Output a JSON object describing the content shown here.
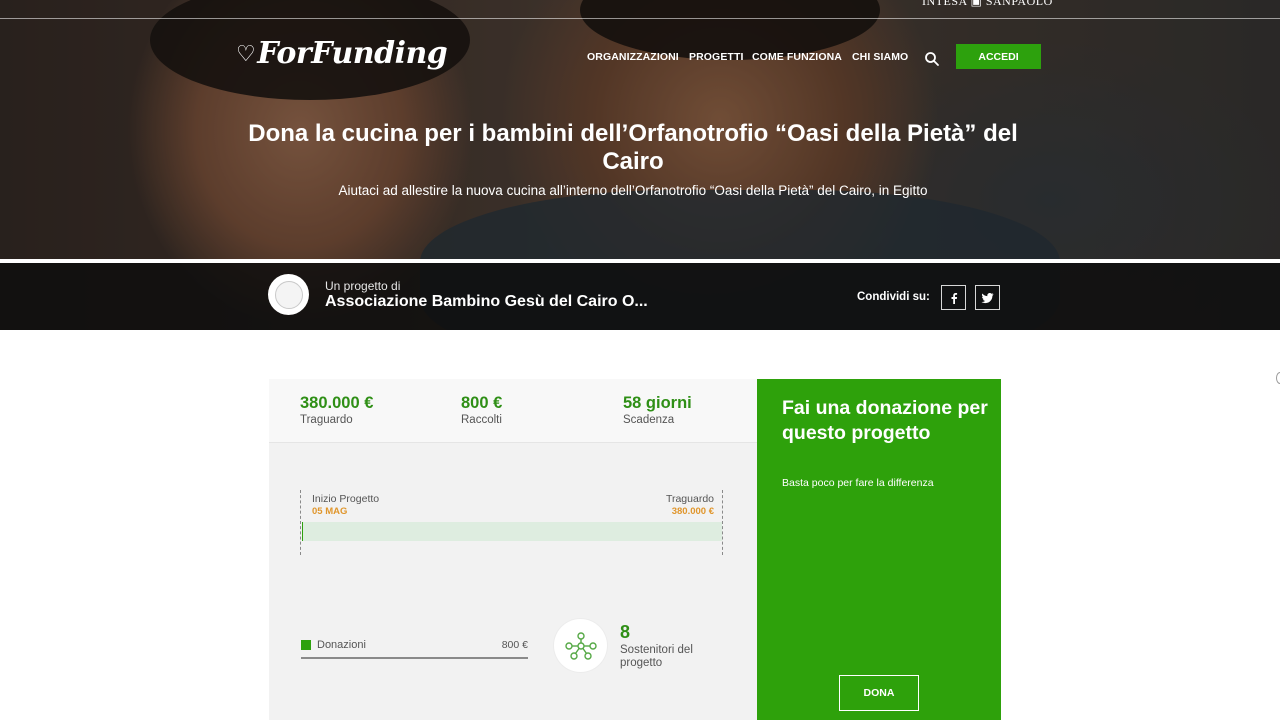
{
  "header": {
    "sponsor": "INTESA ▣ SANPAOLO",
    "logo_text": "ForFunding",
    "nav": [
      "ORGANIZZAZIONI",
      "PROGETTI",
      "COME FUNZIONA",
      "CHI SIAMO"
    ],
    "login_label": "ACCEDI"
  },
  "hero": {
    "title": "Dona la cucina per i bambini dell’Orfanotrofio “Oasi della Pietà” del Cairo",
    "subtitle": "Aiutaci ad allestire la nuova cucina all’interno dell’Orfanotrofio “Oasi della Pietà” del Cairo, in Egitto"
  },
  "organization": {
    "prefix": "Un progetto di",
    "name": "Associazione Bambino Gesù del Cairo O...",
    "share_label": "Condividi su:"
  },
  "stats": [
    {
      "value": "380.000 €",
      "label": "Traguardo"
    },
    {
      "value": "800 €",
      "label": "Raccolti"
    },
    {
      "value": "58 giorni",
      "label": "Scadenza"
    }
  ],
  "timeline": {
    "start_label": "Inizio Progetto",
    "start_value": "05 MAG",
    "end_label": "Traguardo",
    "end_value": "380.000 €",
    "progress_fraction": 0.002
  },
  "donations": {
    "label": "Donazioni",
    "amount": "800 €"
  },
  "supporters": {
    "count": "8",
    "label": "Sostenitori del progetto"
  },
  "donate": {
    "title": "Fai una donazione per questo progetto",
    "subtitle": "Basta poco per fare la differenza",
    "button": "DONA"
  },
  "colors": {
    "brand_green": "#2da10d",
    "stat_green": "#2f8f16",
    "accent_orange": "#e0962c"
  }
}
